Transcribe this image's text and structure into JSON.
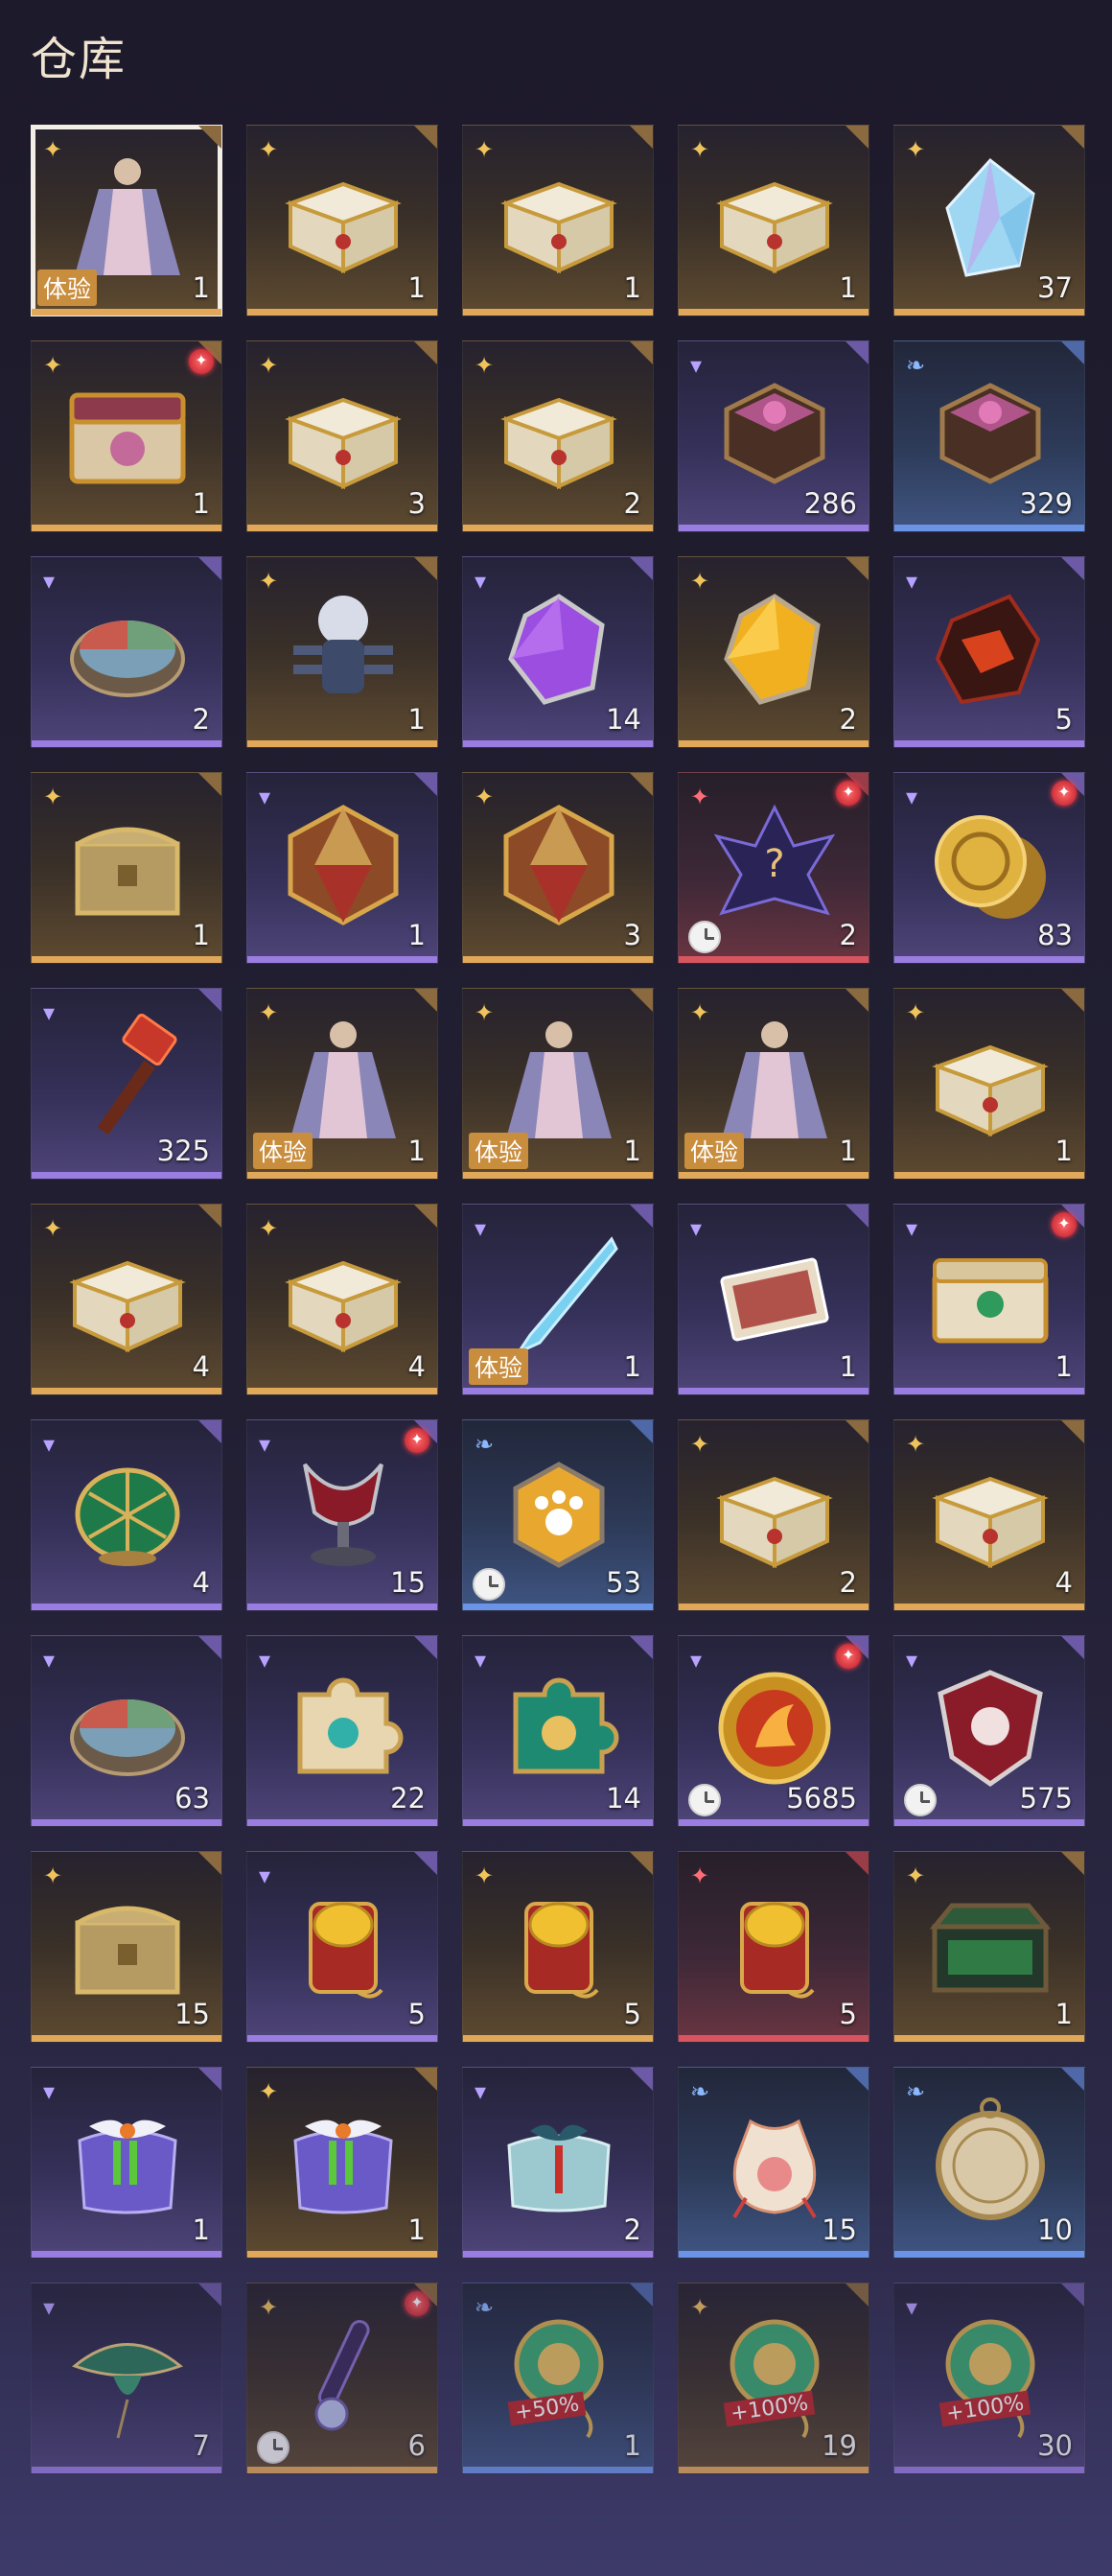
{
  "header": {
    "title": "仓库"
  },
  "labels": {
    "trial": "体验"
  },
  "colors": {
    "gold": "#e2a85a",
    "purple": "#9a7de0",
    "red": "#d85560",
    "blue": "#6c94e6"
  },
  "items": [
    {
      "icon": "costume-icon",
      "rarity": "gold",
      "qty": "1",
      "trial": true,
      "selected": true
    },
    {
      "icon": "white-gold-chest-icon",
      "rarity": "gold",
      "qty": "1"
    },
    {
      "icon": "white-gold-chest-icon",
      "rarity": "gold",
      "qty": "1"
    },
    {
      "icon": "white-gold-chest-icon",
      "rarity": "gold",
      "qty": "1"
    },
    {
      "icon": "crystal-icon",
      "rarity": "gold",
      "qty": "37"
    },
    {
      "icon": "ornate-chest-icon",
      "rarity": "gold",
      "qty": "1",
      "badge": true
    },
    {
      "icon": "white-gold-chest-icon",
      "rarity": "gold",
      "qty": "3"
    },
    {
      "icon": "white-gold-chest-icon",
      "rarity": "gold",
      "qty": "2"
    },
    {
      "icon": "hexagon-box-icon",
      "rarity": "purple",
      "qty": "286"
    },
    {
      "icon": "hexagon-box-icon",
      "rarity": "blue",
      "qty": "329"
    },
    {
      "icon": "three-color-disc-icon",
      "rarity": "purple",
      "qty": "2"
    },
    {
      "icon": "lion-figure-icon",
      "rarity": "gold",
      "qty": "1"
    },
    {
      "icon": "purple-gem-icon",
      "rarity": "purple",
      "qty": "14"
    },
    {
      "icon": "gold-gem-icon",
      "rarity": "gold",
      "qty": "2"
    },
    {
      "icon": "red-ore-icon",
      "rarity": "purple",
      "qty": "5"
    },
    {
      "icon": "gold-chest-icon",
      "rarity": "gold",
      "qty": "1"
    },
    {
      "icon": "d20-dice-icon",
      "rarity": "purple",
      "qty": "1"
    },
    {
      "icon": "d20-dice-icon",
      "rarity": "gold",
      "qty": "3"
    },
    {
      "icon": "mystery-creature-icon",
      "rarity": "red",
      "qty": "2",
      "badge": true,
      "clock": true
    },
    {
      "icon": "gold-coin-icon",
      "rarity": "purple",
      "qty": "83",
      "badge": true
    },
    {
      "icon": "hammer-icon",
      "rarity": "purple",
      "qty": "325"
    },
    {
      "icon": "costume-icon",
      "rarity": "gold",
      "qty": "1",
      "trial": true
    },
    {
      "icon": "costume-icon",
      "rarity": "gold",
      "qty": "1",
      "trial": true
    },
    {
      "icon": "costume-icon",
      "rarity": "gold",
      "qty": "1",
      "trial": true
    },
    {
      "icon": "white-gold-chest-icon",
      "rarity": "gold",
      "qty": "1"
    },
    {
      "icon": "white-gold-chest-icon",
      "rarity": "gold",
      "qty": "4"
    },
    {
      "icon": "white-gold-chest-icon",
      "rarity": "gold",
      "qty": "4"
    },
    {
      "icon": "ice-blade-icon",
      "rarity": "purple",
      "qty": "1",
      "trial": true
    },
    {
      "icon": "card-icon",
      "rarity": "purple",
      "qty": "1"
    },
    {
      "icon": "jade-chest-icon",
      "rarity": "purple",
      "qty": "1",
      "badge": true
    },
    {
      "icon": "lotus-icon",
      "rarity": "purple",
      "qty": "4"
    },
    {
      "icon": "chalice-icon",
      "rarity": "purple",
      "qty": "15",
      "badge": true
    },
    {
      "icon": "paw-tag-icon",
      "rarity": "blue",
      "qty": "53",
      "clock": true
    },
    {
      "icon": "white-gold-chest-icon",
      "rarity": "gold",
      "qty": "2"
    },
    {
      "icon": "white-gold-chest-icon",
      "rarity": "gold",
      "qty": "4"
    },
    {
      "icon": "three-color-disc-icon",
      "rarity": "purple",
      "qty": "63"
    },
    {
      "icon": "puzzle-piece-icon",
      "rarity": "purple",
      "qty": "22"
    },
    {
      "icon": "green-puzzle-icon",
      "rarity": "purple",
      "qty": "14"
    },
    {
      "icon": "fire-medal-icon",
      "rarity": "purple",
      "qty": "5685",
      "badge": true,
      "clock": true
    },
    {
      "icon": "shield-emblem-icon",
      "rarity": "purple",
      "qty": "575",
      "clock": true
    },
    {
      "icon": "gold-chest-icon",
      "rarity": "gold",
      "qty": "15"
    },
    {
      "icon": "red-gold-tag-icon",
      "rarity": "purple",
      "qty": "5"
    },
    {
      "icon": "red-gold-tag-icon",
      "rarity": "gold",
      "qty": "5"
    },
    {
      "icon": "red-gold-tag-icon",
      "rarity": "red",
      "qty": "5"
    },
    {
      "icon": "dark-jade-chest-icon",
      "rarity": "gold",
      "qty": "1"
    },
    {
      "icon": "gift-bundle-icon",
      "rarity": "purple",
      "qty": "1"
    },
    {
      "icon": "gift-bundle-icon",
      "rarity": "gold",
      "qty": "1"
    },
    {
      "icon": "cloth-bundle-icon",
      "rarity": "purple",
      "qty": "2"
    },
    {
      "icon": "pouch-icon",
      "rarity": "blue",
      "qty": "15"
    },
    {
      "icon": "drum-icon",
      "rarity": "blue",
      "qty": "10"
    },
    {
      "icon": "kite-icon",
      "rarity": "purple",
      "qty": "7"
    },
    {
      "icon": "flute-icon",
      "rarity": "gold",
      "qty": "6",
      "badge": true,
      "clock": true
    },
    {
      "icon": "boost-tag-icon",
      "rarity": "blue",
      "qty": "1",
      "boost": "+50%"
    },
    {
      "icon": "boost-tag-icon",
      "rarity": "gold",
      "qty": "19",
      "boost": "+100%"
    },
    {
      "icon": "boost-tag-icon",
      "rarity": "purple",
      "qty": "30",
      "boost": "+100%"
    }
  ]
}
